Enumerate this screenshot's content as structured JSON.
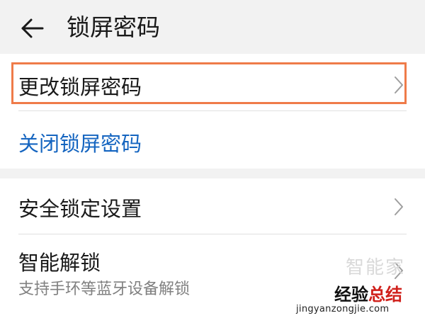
{
  "header": {
    "title": "锁屏密码"
  },
  "lock_password_section": {
    "change_password_label": "更改锁屏密码",
    "turn_off_password_label": "关闭锁屏密码"
  },
  "security_section": {
    "secure_lock_settings_label": "安全锁定设置",
    "smart_unlock_label": "智能解锁",
    "smart_unlock_subtitle": "支持手环等蓝牙设备解锁"
  },
  "watermark": {
    "faded_text": "智能家",
    "brand_black": "经验",
    "brand_red": "总结",
    "url": "jingyanzongjie.com"
  },
  "colors": {
    "link_blue": "#1565c0",
    "highlight_orange": "#ef7b49",
    "background": "#f2f2f2"
  },
  "icons": {
    "back": "arrow-left-icon",
    "chevron": "chevron-right-icon"
  }
}
